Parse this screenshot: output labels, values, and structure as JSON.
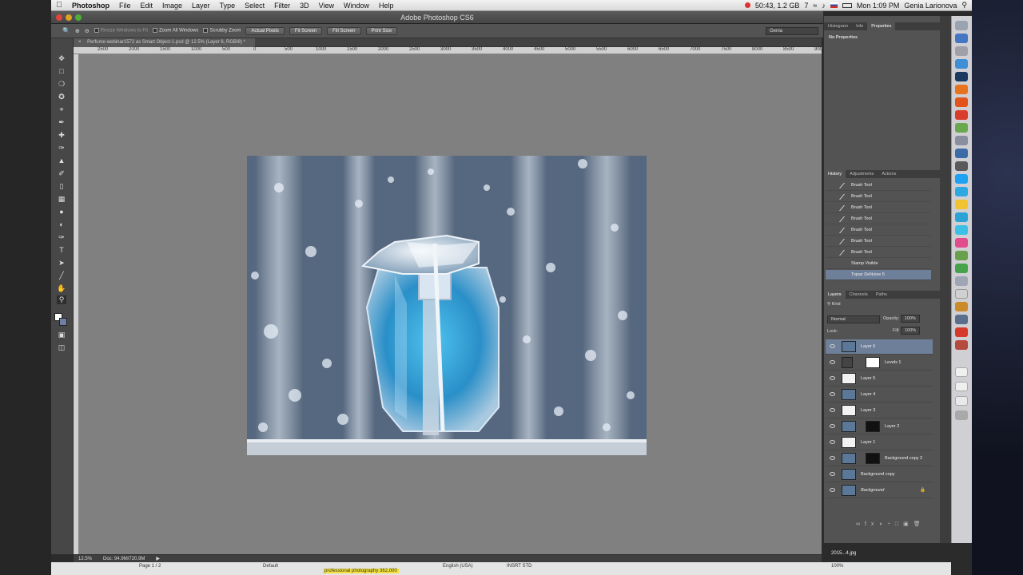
{
  "menubar": {
    "app_name": "Photoshop",
    "items": [
      "File",
      "Edit",
      "Image",
      "Layer",
      "Type",
      "Select",
      "Filter",
      "3D",
      "View",
      "Window",
      "Help"
    ],
    "status_text": "50:43, 1.2 GB",
    "clock": "Mon 1:09 PM",
    "user": "Genia Larionova",
    "badge": "7"
  },
  "window": {
    "title": "Adobe Photoshop CS6"
  },
  "options_bar": {
    "resize_windows": "Resize Windows to Fit",
    "zoom_all": "Zoom All Windows",
    "scrubby": "Scrubby Zoom",
    "buttons": [
      "Actual Pixels",
      "Fit Screen",
      "Fill Screen",
      "Print Size"
    ],
    "workspace": "Genia"
  },
  "document": {
    "tab_title": "Perfume-webinar1572 as Smart Object-1.psd @ 12.5% (Layer 6, RGB/8) *",
    "zoom": "12.5%",
    "doc_size": "Doc: 94.9M/720.9M"
  },
  "ruler": {
    "ticks": [
      "2500",
      "2000",
      "1500",
      "1000",
      "500",
      "0",
      "500",
      "1000",
      "1500",
      "2000",
      "2500",
      "3000",
      "3500",
      "4000",
      "4500",
      "5000",
      "5500",
      "6000",
      "6500",
      "7000",
      "7500",
      "8000",
      "8500",
      "9000"
    ]
  },
  "properties_panel": {
    "tabs": [
      "Histogram",
      "Info",
      "Properties"
    ],
    "message": "No Properties"
  },
  "history_panel": {
    "tabs": [
      "History",
      "Adjustments",
      "Actions"
    ],
    "items": [
      "Brush Tool",
      "Brush Tool",
      "Brush Tool",
      "Brush Tool",
      "Brush Tool",
      "Brush Tool",
      "Brush Tool",
      "Stamp Visible",
      "Topaz DeNoise 5"
    ],
    "selected_index": 8
  },
  "layers_panel": {
    "tabs": [
      "Layers",
      "Channels",
      "Paths"
    ],
    "filter": "Kind",
    "blend_mode": "Normal",
    "opacity_label": "Opacity:",
    "opacity_value": "100%",
    "lock_label": "Lock:",
    "fill_label": "Fill:",
    "fill_value": "100%",
    "layers": [
      "Layer 6",
      "Levels 1",
      "Layer 5",
      "Layer 4",
      "Layer 3",
      "Layer 2",
      "Layer 1",
      "Background copy 2",
      "Background copy",
      "Background"
    ],
    "selected_index": 0
  },
  "bottom_window": {
    "page": "Page 1 / 2",
    "style": "Default",
    "language": "English (USA)",
    "mode": "INSRT   STD",
    "highlight": "professional photography 362,000",
    "zoom": "100%",
    "file": "2015...4.jpg"
  },
  "colors": {
    "accent": "#6d7f99",
    "canvas_bg": "#808080",
    "panel_bg": "#535353"
  }
}
